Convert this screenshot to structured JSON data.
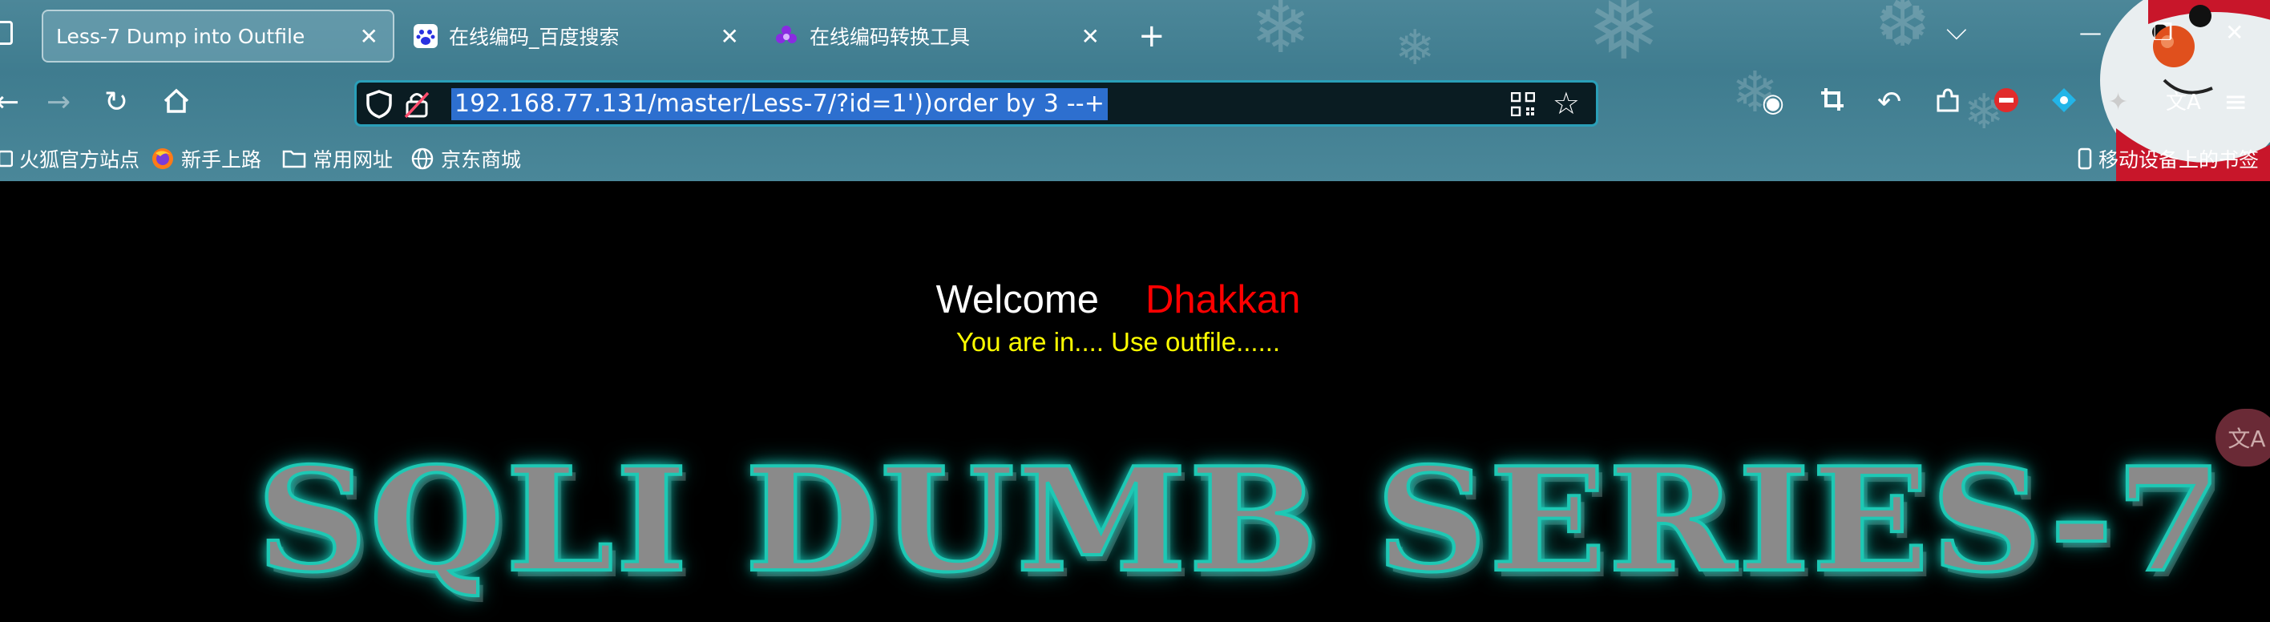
{
  "tabs": [
    {
      "title": "Less-7 Dump into Outfile",
      "active": true,
      "icon": "none"
    },
    {
      "title": "在线编码_百度搜索",
      "active": false,
      "icon": "baidu-paw-icon"
    },
    {
      "title": "在线编码转换工具",
      "active": false,
      "icon": "purple-flower-icon"
    }
  ],
  "address_bar": {
    "url": "192.168.77.131/master/Less-7/?id=1'))order by 3 --+"
  },
  "bookmarks": [
    {
      "label": "火狐官方站点",
      "icon": "folder-icon"
    },
    {
      "label": "新手上路",
      "icon": "firefox-icon"
    },
    {
      "label": "常用网址",
      "icon": "folder-icon"
    },
    {
      "label": "京东商城",
      "icon": "globe-icon"
    }
  ],
  "mobile_bookmarks": "移动设备上的书签",
  "page": {
    "welcome": "Welcome",
    "name": "Dhakkan",
    "message": "You are in.... Use outfile......",
    "banner": "SQLI DUMB SERIES-7"
  },
  "colors": {
    "chrome": "#4a8799",
    "url_highlight": "#2d6fcf",
    "name": "#ff0000",
    "message": "#ffff00",
    "banner_glow": "#1ec8b4"
  }
}
